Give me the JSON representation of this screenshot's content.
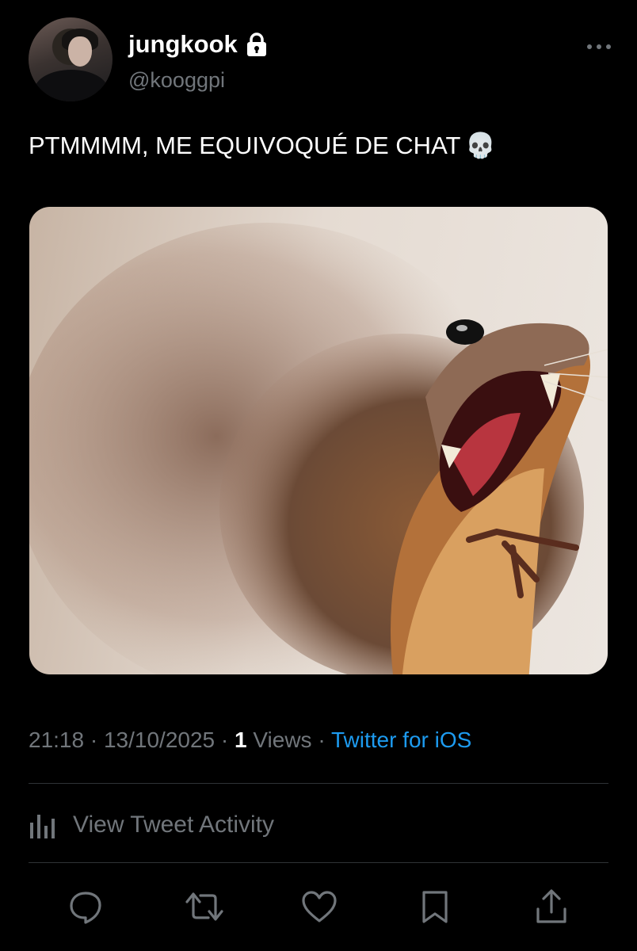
{
  "author": {
    "display_name": "jungkook",
    "handle": "@kooggpi",
    "protected": true
  },
  "more_icon": "more-horizontal-icon",
  "tweet": {
    "text": "PTMMMM, ME EQUIVOQUÉ DE CHAT",
    "emoji": "💀",
    "media_description_icon": "photo"
  },
  "meta": {
    "time": "21:18",
    "sep1": " · ",
    "date": "13/10/2025",
    "sep2": " · ",
    "views_count": "1",
    "views_label": " Views",
    "sep3": " · ",
    "source": "Twitter for iOS"
  },
  "activity": {
    "label": "View Tweet Activity",
    "icon": "bar-chart-icon"
  },
  "actions": [
    "reply-icon",
    "retweet-icon",
    "like-icon",
    "bookmark-icon",
    "share-icon"
  ],
  "colors": {
    "background": "#000000",
    "text": "#ffffff",
    "muted": "#71767b",
    "link": "#1d9bf0",
    "divider": "#2f3336"
  }
}
